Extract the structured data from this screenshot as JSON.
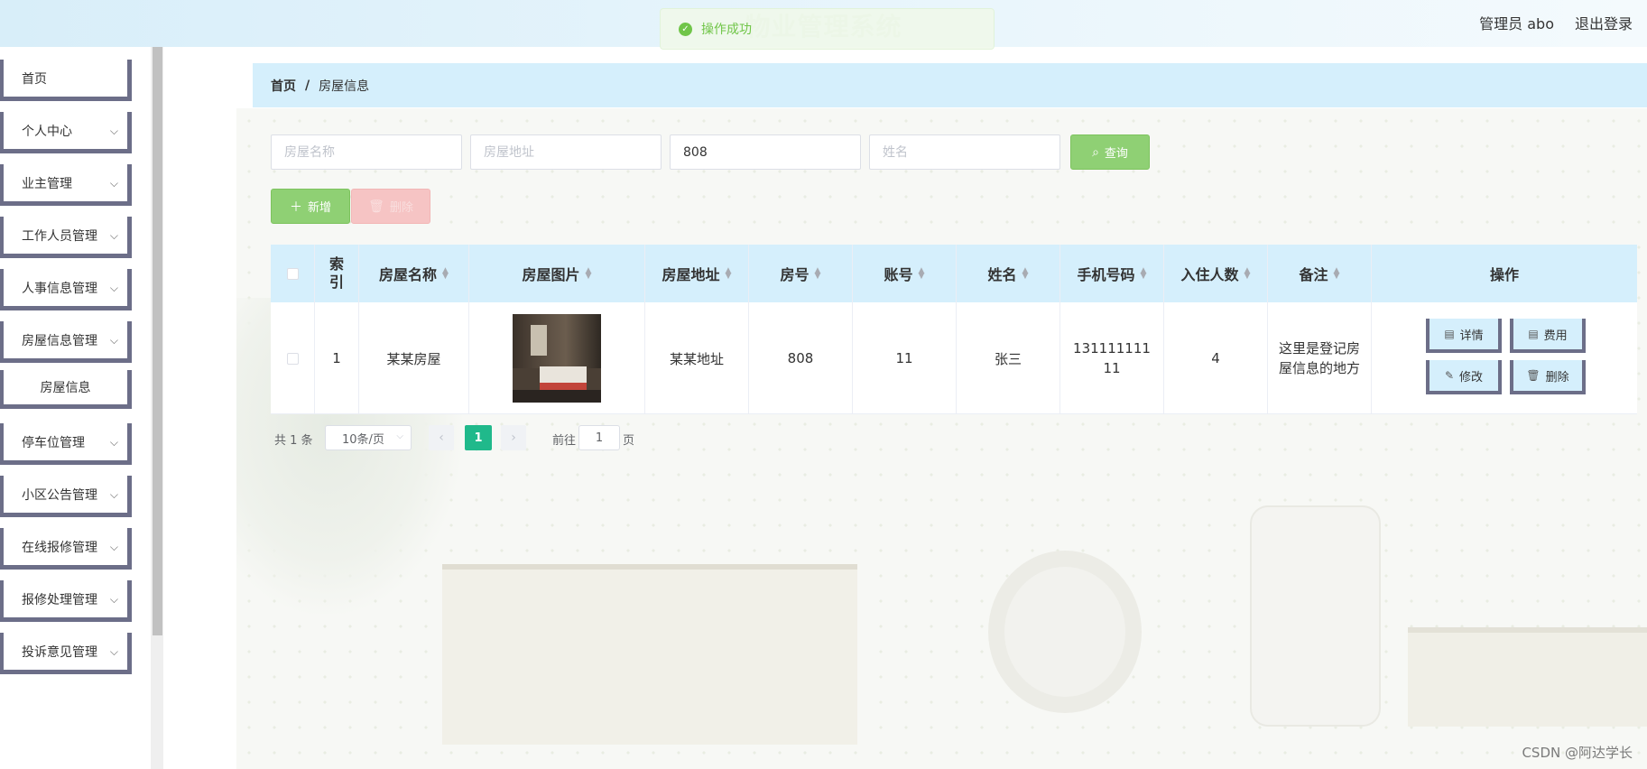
{
  "header": {
    "title": "物业管理系统",
    "user": "管理员 abo",
    "logout": "退出登录"
  },
  "toast": {
    "text": "操作成功",
    "icon": "check-circle-icon"
  },
  "sidebar": {
    "items": [
      {
        "label": "首页"
      },
      {
        "label": "个人中心"
      },
      {
        "label": "业主管理"
      },
      {
        "label": "工作人员管理"
      },
      {
        "label": "人事信息管理"
      },
      {
        "label": "房屋信息管理"
      },
      {
        "label": "房屋信息"
      },
      {
        "label": "停车位管理"
      },
      {
        "label": "小区公告管理"
      },
      {
        "label": "在线报修管理"
      },
      {
        "label": "报修处理管理"
      },
      {
        "label": "投诉意见管理"
      }
    ]
  },
  "breadcrumb": {
    "home": "首页",
    "separator": "/",
    "current": "房屋信息"
  },
  "search": {
    "house_name_placeholder": "房屋名称",
    "house_address_placeholder": "房屋地址",
    "room_value": "808",
    "name_placeholder": "姓名",
    "search_label": "查询"
  },
  "actions": {
    "add_label": "新增",
    "delete_label": "删除"
  },
  "table": {
    "headers": [
      "索引",
      "房屋名称",
      "房屋图片",
      "房屋地址",
      "房号",
      "账号",
      "姓名",
      "手机号码",
      "入住人数",
      "备注",
      "操作"
    ],
    "rows": [
      {
        "index": "1",
        "house_name": "某某房屋",
        "address": "某某地址",
        "room": "808",
        "account": "11",
        "name": "张三",
        "phone": "13111111111",
        "residents": "4",
        "note": "这里是登记房屋信息的地方"
      }
    ],
    "ops": {
      "detail": "详情",
      "fee": "费用",
      "edit": "修改",
      "delete": "删除"
    }
  },
  "pagination": {
    "total": "共 1 条",
    "page_size": "10条/页",
    "current_page": "1",
    "goto_label": "前往",
    "goto_value": "1",
    "page_suffix": "页"
  },
  "watermark": "CSDN @阿达学长",
  "colors": {
    "accent_green": "#67c23a",
    "table_header": "#d5effc",
    "pager_active": "#20b98b"
  }
}
